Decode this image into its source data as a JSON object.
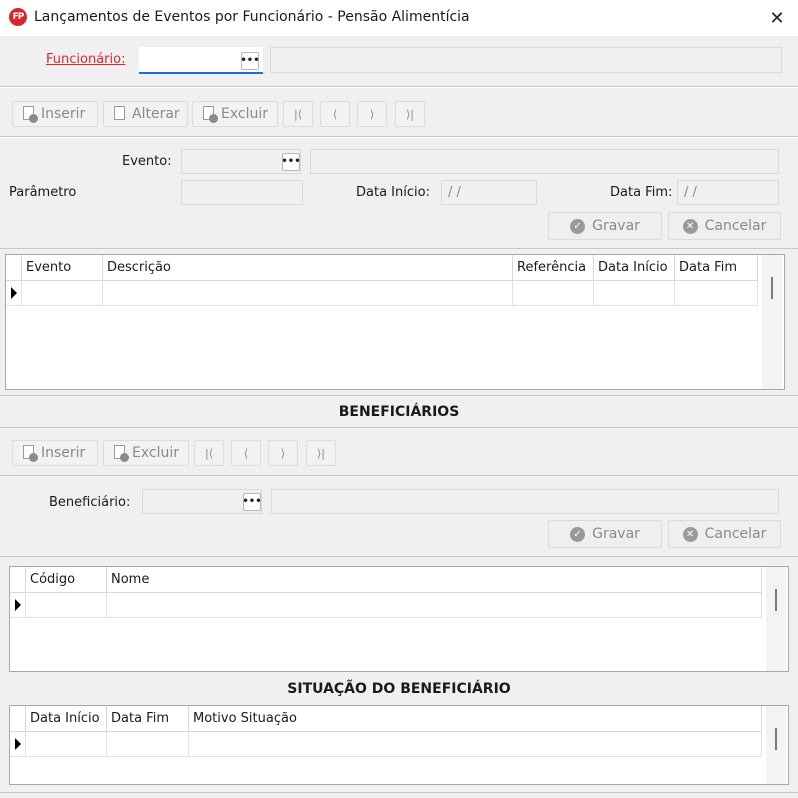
{
  "window": {
    "title": "Lançamentos de Eventos por Funcionário - Pensão Alimentícia",
    "app_icon_text": "FP",
    "close_glyph": "✕"
  },
  "funcionario": {
    "label": "Funcionário:",
    "code_value": "",
    "name_value": "",
    "lookup_glyph": "•••"
  },
  "toolbar1": {
    "inserir": "Inserir",
    "alterar": "Alterar",
    "excluir": "Excluir",
    "first_glyph": "|⟨",
    "prev_glyph": "⟨",
    "next_glyph": "⟩",
    "last_glyph": "⟩|"
  },
  "evento_form": {
    "evento_label": "Evento:",
    "evento_code": "",
    "evento_desc": "",
    "parametro_label": "Parâmetro",
    "parametro_value": "",
    "data_inicio_label": "Data Início:",
    "data_inicio_value": " / /",
    "data_fim_label": "Data Fim:",
    "data_fim_value": " / /",
    "gravar": "Gravar",
    "cancelar": "Cancelar"
  },
  "eventos_grid": {
    "columns": [
      "Evento",
      "Descrição",
      "Referência",
      "Data Início",
      "Data Fim"
    ]
  },
  "beneficiarios": {
    "section_title": "BENEFICIÁRIOS",
    "inserir": "Inserir",
    "excluir": "Excluir",
    "beneficiario_label": "Beneficiário:",
    "beneficiario_code": "",
    "beneficiario_name": "",
    "gravar": "Gravar",
    "cancelar": "Cancelar",
    "columns": [
      "Código",
      "Nome"
    ]
  },
  "situacao": {
    "section_title": "SITUAÇÃO DO BENEFICIÁRIO",
    "columns": [
      "Data Início",
      "Data Fim",
      "Motivo Situação"
    ]
  },
  "colors": {
    "required_label": "#e4242b",
    "focus_underline": "#1a6fd1",
    "app_icon": "#d9262c"
  }
}
